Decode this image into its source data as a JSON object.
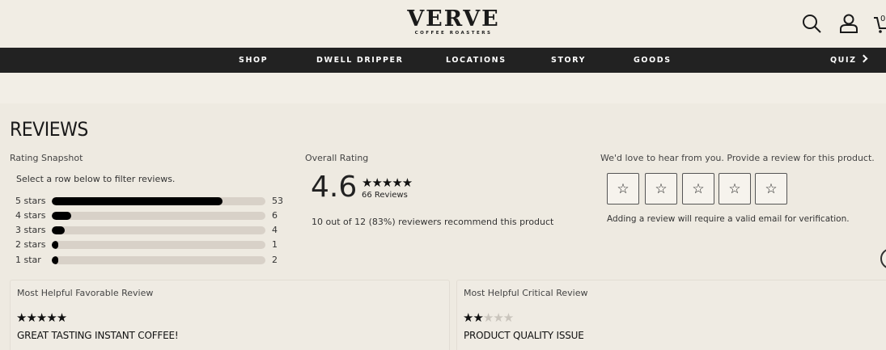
{
  "header": {
    "logo_main": "VERVE",
    "logo_sub": "COFFEE ROASTERS",
    "cart_count": "0",
    "icons": [
      "search-icon",
      "account-icon",
      "cart-icon"
    ]
  },
  "nav": {
    "items": [
      "SHOP",
      "DWELL DRIPPER",
      "LOCATIONS",
      "STORY",
      "GOODS",
      "QUIZ"
    ]
  },
  "reviews": {
    "title": "REVIEWS",
    "snapshot": {
      "heading": "Rating Snapshot",
      "instruction": "Select a row below to filter reviews.",
      "rows": [
        {
          "label": "5 stars",
          "count": "53",
          "fraction": 0.8
        },
        {
          "label": "4 stars",
          "count": "6",
          "fraction": 0.09
        },
        {
          "label": "3 stars",
          "count": "4",
          "fraction": 0.06
        },
        {
          "label": "2 stars",
          "count": "1",
          "fraction": 0.015
        },
        {
          "label": "1 star",
          "count": "2",
          "fraction": 0.03
        }
      ]
    },
    "overall": {
      "heading": "Overall Rating",
      "value": "4.6",
      "stars": "★★★★★",
      "review_count": "66 Reviews",
      "recommend": "10 out of 12 (83%) reviewers recommend this product"
    },
    "write": {
      "prompt": "We'd love to hear from you. Provide a review for this product.",
      "star_icon": "☆",
      "note": "Adding a review will require a valid email for verification."
    },
    "favorable": {
      "label": "Most Helpful Favorable Review",
      "stars_filled": "★★★★★",
      "stars_empty": "",
      "title": "GREAT TASTING INSTANT COFFEE!"
    },
    "critical": {
      "label": "Most Helpful Critical Review",
      "stars_filled": "★★",
      "stars_empty": "★★★",
      "title": "PRODUCT QUALITY ISSUE"
    }
  },
  "colors": {
    "background": "#eeeae1",
    "nav_bar": "#222222",
    "bar_fill": "#000000",
    "bar_track": "#d8d1c8"
  }
}
